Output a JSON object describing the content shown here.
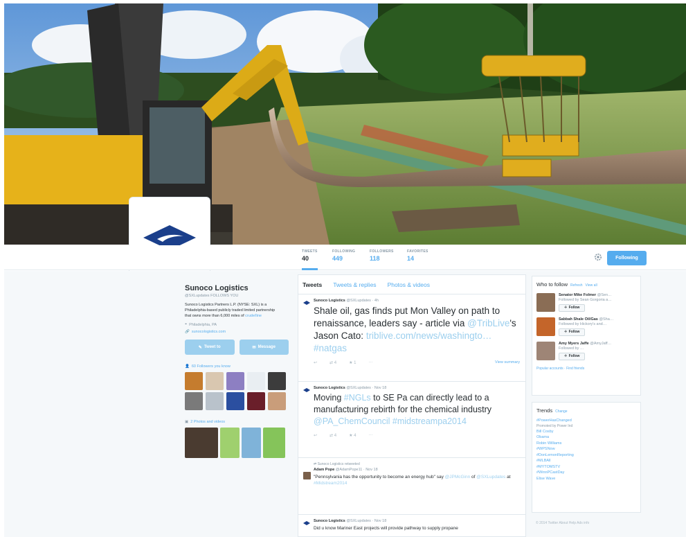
{
  "profile_nav": {
    "stats": [
      {
        "label": "TWEETS",
        "value": "40"
      },
      {
        "label": "FOLLOWING",
        "value": "449"
      },
      {
        "label": "FOLLOWERS",
        "value": "118"
      },
      {
        "label": "FAVORITES",
        "value": "14"
      }
    ],
    "follow_button": "Following"
  },
  "profile": {
    "name": "Sunoco Logistics",
    "handle": "@SXLupdates",
    "follows_you": "FOLLOWS YOU",
    "bio": "Sunoco Logistics Partners L.P. (NYSE: SXL) is a Philadelphia-based publicly traded limited partnership that owns more than 6,000 miles of",
    "bio_link": "crude/line",
    "location": "Philadelphia, PA",
    "website": "sunocologistics.com",
    "tweet_to_button": "Tweet to",
    "message_button": "Message",
    "followers_you_know": "60 Followers you know",
    "photos_videos": "2 Photos and videos"
  },
  "timeline": {
    "tabs": [
      "Tweets",
      "Tweets & replies",
      "Photos & videos"
    ],
    "tweets": [
      {
        "author": "Sunoco Logistics",
        "handle": "@SXLupdates",
        "time": "4h",
        "text": "Shale oil, gas finds put Mon Valley on path to renaissance, leaders say - article via",
        "link1": "@TribLive",
        "text2": "'s Jason Cato:",
        "link2": "triblive.com/news/washingto…",
        "hashtag": "#natgas",
        "retweets": "4",
        "favorites": "1",
        "more": "View summary"
      },
      {
        "author": "Sunoco Logistics",
        "handle": "@SXLupdates",
        "time": "Nov 18",
        "text": "Moving",
        "hashtag1": "#NGLs",
        "text2": "to SE Pa can directly lead to a manufacturing rebirth for the chemical industry",
        "link1": "@PA_ChemCouncil",
        "hashtag2": "#midstreampa2014",
        "retweets": "4",
        "favorites": "4"
      },
      {
        "retweeted_by": "Sunoco Logistics retweeted",
        "author": "Adam Pope",
        "handle": "@AdamPope11",
        "time": "Nov 18",
        "text": "\"Pennsylvania has the opportunity to become an energy hub\" say",
        "link1": "@JPMcGinn",
        "text2": "of",
        "link2": "@SXLupdates",
        "text3": "at",
        "link3": "#Midstream2014"
      },
      {
        "author": "Sunoco Logistics",
        "handle": "@SXLupdates",
        "time": "Nov 18",
        "text": "Did u know Mariner East projects will provide pathway to supply propane"
      }
    ]
  },
  "who_to_follow": {
    "title": "Who to follow",
    "refresh": "Refresh",
    "view_all": "View all",
    "suggestions": [
      {
        "name": "Senator Mike Folmer",
        "handle": "@Sen…",
        "followed_by": "Followed by Sean Gorgoria a…",
        "button": "Follow"
      },
      {
        "name": "Sabbah Shale Oil/Gas",
        "handle": "@Sha…",
        "followed_by": "Followed by Hickory's and…",
        "button": "Follow"
      },
      {
        "name": "Amy Myers Jaffe",
        "handle": "@AmyJaff…",
        "followed_by": "Followed by …",
        "button": "Follow"
      }
    ],
    "footer": "Popular accounts · Find friends"
  },
  "trends": {
    "title": "Trends",
    "change": "Change",
    "items": [
      "#PowerHasChanged",
      "Promoted by Power Ind",
      "Bill Cosby",
      "Obama",
      "Robin Williams",
      "#WPSNow",
      "#DonLemonReporting",
      "#MLBAll",
      "#MYTOMSTV",
      "#WinnPCastDay",
      "Elise Wave"
    ]
  },
  "footer": "© 2014 Twitter   About   Help   Ads info",
  "colors": {
    "accent": "#55acee",
    "accent_soft": "#9ccfee",
    "brand_blue": "#1b3f8b"
  }
}
